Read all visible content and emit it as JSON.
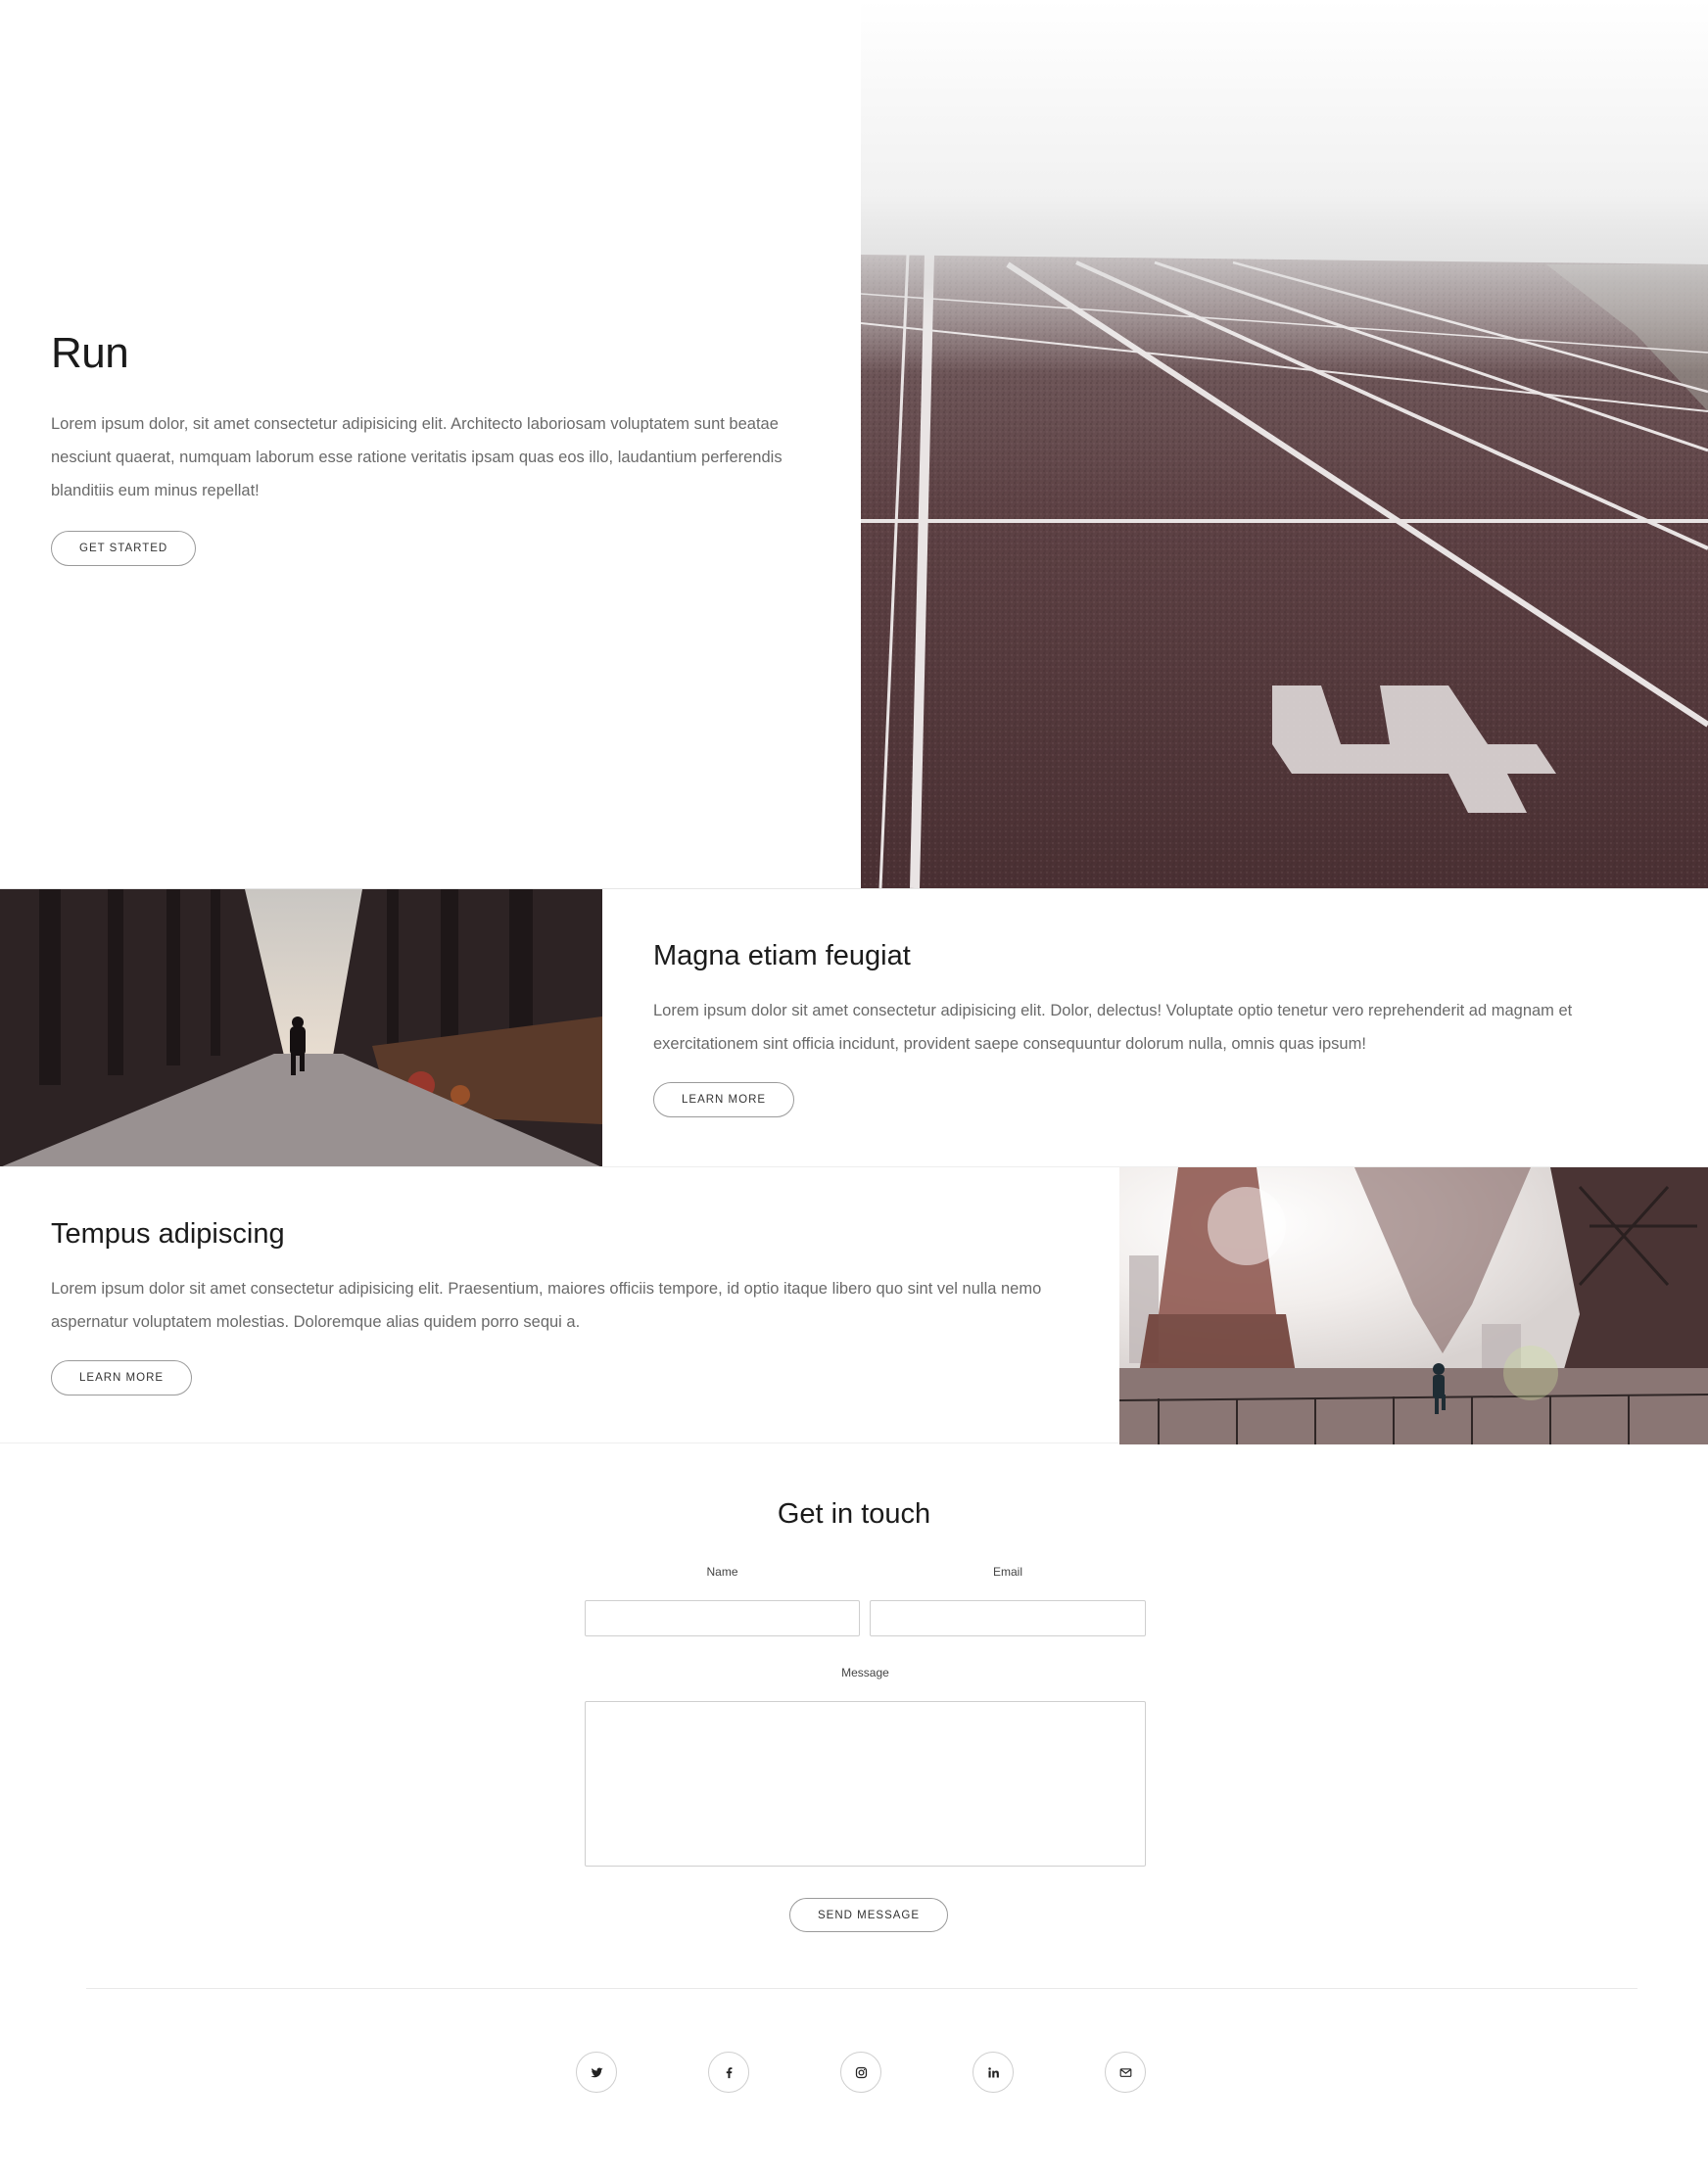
{
  "hero": {
    "title": "Run",
    "text": "Lorem ipsum dolor, sit amet consectetur adipisicing elit. Architecto laboriosam voluptatem sunt beatae nesciunt quaerat, numquam laborum esse ratione veritatis ipsam quas eos illo, laudantium perferendis blanditiis eum minus repellat!",
    "button": "GET STARTED",
    "image_icon": "running-track-lane-4-photo"
  },
  "feature1": {
    "title": "Magna etiam feugiat",
    "text": "Lorem ipsum dolor sit amet consectetur adipisicing elit. Dolor, delectus! Voluptate optio tenetur vero reprehenderit ad magnam et exercitationem sint officia incidunt, provident saepe consequuntur dolorum nulla, omnis quas ipsum!",
    "button": "LEARN MORE",
    "image_icon": "forest-trail-runner-photo"
  },
  "feature2": {
    "title": "Tempus adipiscing",
    "text": "Lorem ipsum dolor sit amet consectetur adipisicing elit. Praesentium, maiores officiis tempore, id optio itaque libero quo sint vel nulla nemo aspernatur voluptatem molestias. Doloremque alias quidem porro sequi a.",
    "button": "LEARN MORE",
    "image_icon": "bridge-runner-photo"
  },
  "contact": {
    "title": "Get in touch",
    "name_label": "Name",
    "email_label": "Email",
    "message_label": "Message",
    "name_value": "",
    "email_value": "",
    "message_value": "",
    "button": "SEND MESSAGE"
  },
  "socials": [
    {
      "icon": "twitter-icon"
    },
    {
      "icon": "facebook-icon"
    },
    {
      "icon": "instagram-icon"
    },
    {
      "icon": "linkedin-icon"
    },
    {
      "icon": "email-icon"
    }
  ],
  "colors": {
    "background": "#ffffff",
    "heading": "#1b1b1b",
    "body_text": "#6a6a6a",
    "button_border": "#9a9a9a",
    "input_border": "#cfcfcf",
    "track": "#5a3a3c"
  }
}
